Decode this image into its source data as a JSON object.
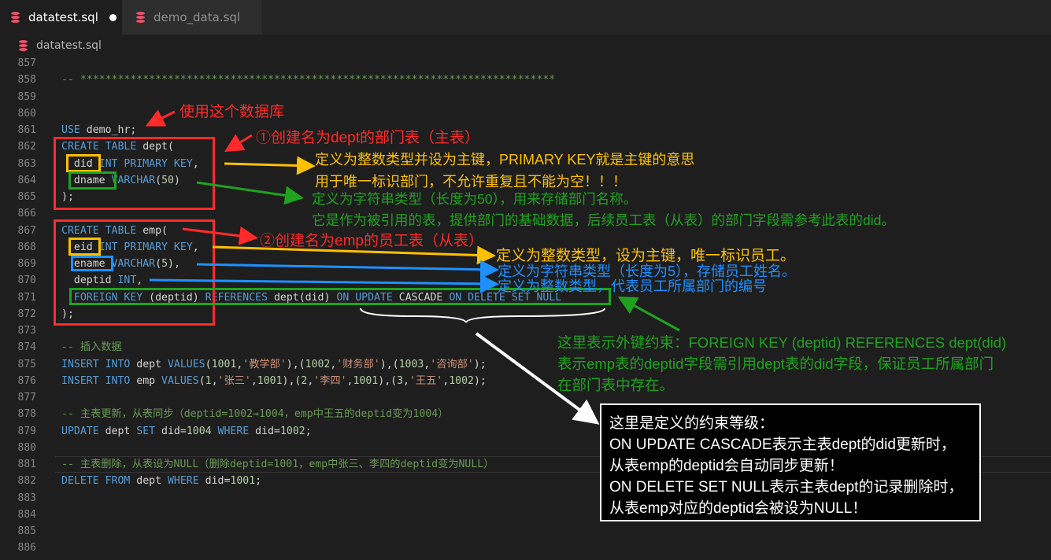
{
  "tabs": [
    {
      "label": "datatest.sql",
      "active": true,
      "unsaved": true
    },
    {
      "label": "demo_data.sql",
      "active": false
    }
  ],
  "breadcrumb": "datatest.sql",
  "line_numbers": [
    "857",
    "858",
    "859",
    "860",
    "861",
    "862",
    "863",
    "864",
    "865",
    "866",
    "867",
    "868",
    "869",
    "870",
    "871",
    "872",
    "873",
    "874",
    "875",
    "876",
    "877",
    "878",
    "879",
    "880",
    "881",
    "882",
    "883",
    "884",
    "885",
    "886"
  ],
  "code": {
    "l858": "-- ****************************************************************************",
    "l861_a": "USE",
    "l861_b": " demo_hr;",
    "l862_a": "CREATE TABLE",
    "l862_b": " dept(",
    "l863_a": "  did",
    "l863_b": " INT PRIMARY KEY",
    "l863_c": ",",
    "l864_a": "  dname",
    "l864_b": " VARCHAR",
    "l864_c": "(",
    "l864_d": "50",
    "l864_e": ")",
    "l865": ");",
    "l867_a": "CREATE TABLE",
    "l867_b": " emp(",
    "l868_a": "  eid",
    "l868_b": " INT PRIMARY KEY",
    "l868_c": ",",
    "l869_a": "  ename",
    "l869_b": " VARCHAR",
    "l869_c": "(",
    "l869_d": "5",
    "l869_e": "),",
    "l870_a": "  deptid",
    "l870_b": " INT",
    "l870_c": ",",
    "l871_a": "  FOREIGN KEY",
    "l871_b": " (deptid) ",
    "l871_c": "REFERENCES",
    "l871_d": " dept(did) ",
    "l871_e": "ON UPDATE",
    "l871_f": " CASCADE ",
    "l871_g": "ON DELETE SET NULL",
    "l872": ");",
    "l874": "-- 插入数据",
    "l875_a": "INSERT INTO",
    "l875_b": " dept ",
    "l875_c": "VALUES",
    "l875_d": "(",
    "l875_e": "1001",
    "l875_f": ",",
    "l875_g": "'教学部'",
    "l875_h": "),(",
    "l875_i": "1002",
    "l875_j": ",",
    "l875_k": "'财务部'",
    "l875_l": "),(",
    "l875_m": "1003",
    "l875_n": ",",
    "l875_o": "'咨询部'",
    "l875_p": ");",
    "l876_a": "INSERT INTO",
    "l876_b": " emp ",
    "l876_c": "VALUES",
    "l876_d": "(",
    "l876_e": "1",
    "l876_f": ",",
    "l876_g": "'张三'",
    "l876_h": ",",
    "l876_i": "1001",
    "l876_j": "),(",
    "l876_k": "2",
    "l876_l": ",",
    "l876_m": "'李四'",
    "l876_n": ",",
    "l876_o": "1001",
    "l876_p": "),(",
    "l876_q": "3",
    "l876_r": ",",
    "l876_s": "'王五'",
    "l876_t": ",",
    "l876_u": "1002",
    "l876_v": ");",
    "l878": "-- 主表更新，从表同步（deptid=1002→1004，emp中王五的deptid变为1004）",
    "l879_a": "UPDATE",
    "l879_b": " dept ",
    "l879_c": "SET",
    "l879_d": " did=",
    "l879_e": "1004",
    "l879_f": " ",
    "l879_g": "WHERE",
    "l879_h": " did=",
    "l879_i": "1002",
    "l879_j": ";",
    "l881": "-- 主表删除，从表设为NULL（删除deptid=1001，emp中张三、李四的deptid变为NULL）",
    "l882_a": "DELETE FROM",
    "l882_b": " dept ",
    "l882_c": "WHERE",
    "l882_d": " did=",
    "l882_e": "1001",
    "l882_f": ";"
  },
  "annotations": {
    "use_db": "使用这个数据库",
    "create_dept": "①创建名为dept的部门表（主表）",
    "did_1": "定义为整数类型并设为主键，PRIMARY KEY就是主键的意思",
    "did_2": "用于唯一标识部门，不允许重复且不能为空！！！",
    "dname_1": "定义为字符串类型（长度为50），用来存储部门名称。",
    "dname_2": "它是作为被引用的表，提供部门的基础数据，后续员工表（从表）的部门字段需参考此表的did。",
    "create_emp": "②创建名为emp的员工表（从表）",
    "eid": "定义为整数类型，设为主键，唯一标识员工。",
    "ename": "定义为字符串类型（长度为5），存储员工姓名。",
    "deptid": "定义为整数类型，代表员工所属部门的编号",
    "fk_1": "这里表示外键约束：FOREIGN KEY (deptid) REFERENCES dept(did)",
    "fk_2": "表示emp表的deptid字段需引用dept表的did字段，保证员工所属部门",
    "fk_3": "在部门表中存在。",
    "note_1": "这里是定义的约束等级：",
    "note_2": "ON UPDATE CASCADE表示主表dept的did更新时，",
    "note_3": "从表emp的deptid会自动同步更新！",
    "note_4": "ON DELETE SET NULL表示主表dept的记录删除时，",
    "note_5": "从表emp对应的deptid会被设为NULL！"
  },
  "colors": {
    "red": "#ff2a2a",
    "yellow": "#ffc000",
    "green": "#1fa31f",
    "blue": "#1e90ff",
    "white": "#ffffff",
    "keyword": "#569cd6",
    "string": "#ce9178",
    "number": "#b5cea8",
    "comment": "#6a9955"
  },
  "icons": [
    "database-icon",
    "unsaved-dot-icon"
  ]
}
